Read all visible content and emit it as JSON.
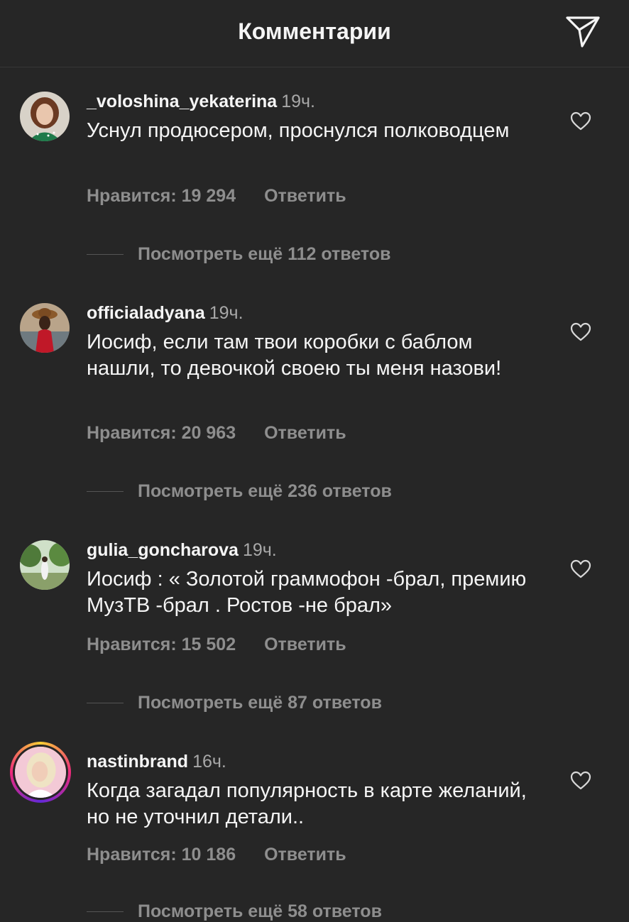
{
  "header": {
    "title": "Комментарии",
    "share_icon": "paper-plane-icon"
  },
  "comments": [
    {
      "username": "_voloshina_yekaterina",
      "time": "19ч.",
      "text": "Уснул продюсером, проснулся полководцем",
      "likes": "Нравится: 19 294",
      "reply": "Ответить",
      "view_replies": "Посмотреть ещё 112 ответов"
    },
    {
      "username": "officialadyana",
      "time": "19ч.",
      "text": "Иосиф, если там твои коробки с баблом нашли, то девочкой своею ты меня назови!",
      "likes": "Нравится: 20 963",
      "reply": "Ответить",
      "view_replies": "Посмотреть ещё 236 ответов"
    },
    {
      "username": "gulia_goncharova",
      "time": "19ч.",
      "text": "Иосиф : « Золотой граммофон -брал, премию МузТВ -брал . Ростов -не брал»",
      "likes": "Нравится: 15 502",
      "reply": "Ответить",
      "view_replies": "Посмотреть ещё 87 ответов"
    },
    {
      "username": "nastinbrand",
      "time": "16ч.",
      "text": "Когда загадал популярность в карте желаний, но не уточнил детали..",
      "likes": "Нравится: 10 186",
      "reply": "Ответить",
      "view_replies": "Посмотреть ещё 58 ответов"
    }
  ],
  "colors": {
    "background": "#262626",
    "text": "#f5f5f5",
    "secondary": "#8e8e8e",
    "story_ring": [
      "#f9ce34",
      "#ee2a7b",
      "#6228d7"
    ]
  }
}
